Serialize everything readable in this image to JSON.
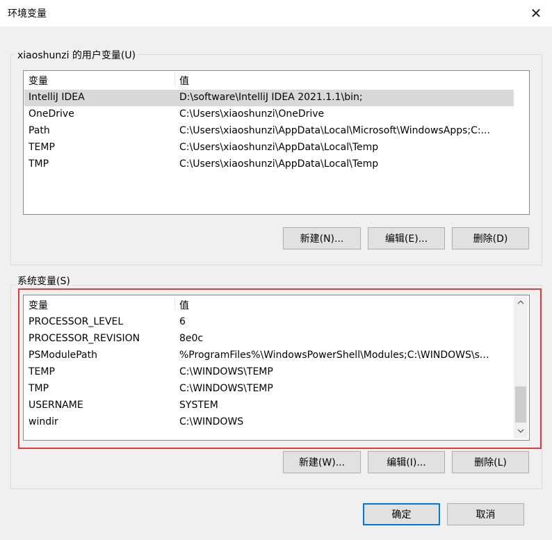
{
  "window": {
    "title": "环境变量",
    "close_glyph": "✕"
  },
  "user_vars": {
    "group_label": "xiaoshunzi 的用户变量(U)",
    "columns": [
      "变量",
      "值"
    ],
    "rows": [
      {
        "name": "IntelliJ IDEA",
        "value": "D:\\software\\IntelliJ IDEA 2021.1.1\\bin;"
      },
      {
        "name": "OneDrive",
        "value": "C:\\Users\\xiaoshunzi\\OneDrive"
      },
      {
        "name": "Path",
        "value": "C:\\Users\\xiaoshunzi\\AppData\\Local\\Microsoft\\WindowsApps;C:..."
      },
      {
        "name": "TEMP",
        "value": "C:\\Users\\xiaoshunzi\\AppData\\Local\\Temp"
      },
      {
        "name": "TMP",
        "value": "C:\\Users\\xiaoshunzi\\AppData\\Local\\Temp"
      }
    ],
    "buttons": {
      "new": "新建(N)...",
      "edit": "编辑(E)...",
      "delete": "删除(D)"
    }
  },
  "system_vars": {
    "group_label": "系统变量(S)",
    "columns": [
      "变量",
      "值"
    ],
    "rows": [
      {
        "name": "PROCESSOR_LEVEL",
        "value": "6"
      },
      {
        "name": "PROCESSOR_REVISION",
        "value": "8e0c"
      },
      {
        "name": "PSModulePath",
        "value": "%ProgramFiles%\\WindowsPowerShell\\Modules;C:\\WINDOWS\\s..."
      },
      {
        "name": "TEMP",
        "value": "C:\\WINDOWS\\TEMP"
      },
      {
        "name": "TMP",
        "value": "C:\\WINDOWS\\TEMP"
      },
      {
        "name": "USERNAME",
        "value": "SYSTEM"
      },
      {
        "name": "windir",
        "value": "C:\\WINDOWS"
      }
    ],
    "buttons": {
      "new": "新建(W)...",
      "edit": "编辑(I)...",
      "delete": "删除(L)"
    }
  },
  "footer": {
    "ok": "确定",
    "cancel": "取消"
  },
  "colors": {
    "highlight": "#e03c3c",
    "default_button_border": "#0078d7"
  }
}
